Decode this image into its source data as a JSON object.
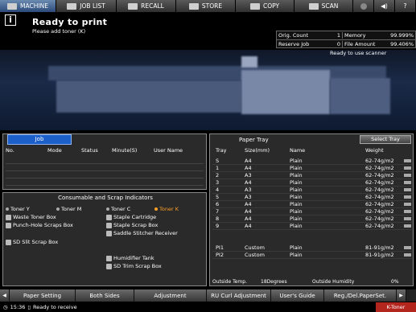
{
  "tabs": {
    "machine": "MACHINE",
    "job_list": "JOB LIST",
    "recall": "RECALL",
    "store": "STORE",
    "copy": "COPY",
    "scan": "SCAN"
  },
  "status": {
    "title": "Ready to print",
    "subtitle": "Please add toner (K)",
    "scanner": "Ready to use scanner"
  },
  "counters": {
    "orig_count_label": "Orig. Count",
    "orig_count_value": "1",
    "memory_label": "Memory",
    "memory_value": "99.999%",
    "reserve_job_label": "Reserve Job",
    "reserve_job_value": "0",
    "file_amount_label": "File Amount",
    "file_amount_value": "99.406%"
  },
  "job_panel": {
    "tab": "Job",
    "columns": [
      "No.",
      "Mode",
      "Status",
      "Minute(S)",
      "User Name"
    ]
  },
  "consumables": {
    "title": "Consumable and Scrap Indicators",
    "items": [
      "Toner Y",
      "Toner M",
      "Toner C",
      "Toner K",
      "Waste Toner Box",
      "Staple Cartridge",
      "Punch-Hole Scraps Box",
      "Staple Scrap Box",
      "Saddle Stitcher Receiver",
      "SD Slit Scrap Box",
      "Humidifier Tank",
      "SD Trim Scrap Box"
    ]
  },
  "paper_tray": {
    "title": "Paper Tray",
    "select_button": "Select Tray",
    "columns": [
      "Tray",
      "Size(mm)",
      "Name",
      "Weight"
    ],
    "rows": [
      {
        "tray": "S",
        "size": "A4",
        "name": "Plain",
        "weight": "62-74g/m2"
      },
      {
        "tray": "1",
        "size": "A4",
        "name": "Plain",
        "weight": "62-74g/m2"
      },
      {
        "tray": "2",
        "size": "A3",
        "name": "Plain",
        "weight": "62-74g/m2"
      },
      {
        "tray": "3",
        "size": "A4",
        "name": "Plain",
        "weight": "62-74g/m2"
      },
      {
        "tray": "4",
        "size": "A3",
        "name": "Plain",
        "weight": "62-74g/m2"
      },
      {
        "tray": "5",
        "size": "A3",
        "name": "Plain",
        "weight": "62-74g/m2"
      },
      {
        "tray": "6",
        "size": "A4",
        "name": "Plain",
        "weight": "62-74g/m2"
      },
      {
        "tray": "7",
        "size": "A4",
        "name": "Plain",
        "weight": "62-74g/m2"
      },
      {
        "tray": "8",
        "size": "A4",
        "name": "Plain",
        "weight": "62-74g/m2"
      },
      {
        "tray": "9",
        "size": "A4",
        "name": "Plain",
        "weight": "62-74g/m2"
      },
      {
        "tray": "PI1",
        "size": "Custom",
        "name": "Plain",
        "weight": "81-91g/m2"
      },
      {
        "tray": "PI2",
        "size": "Custom",
        "name": "Plain",
        "weight": "81-91g/m2"
      }
    ],
    "outside_temp_label": "Outside Temp.",
    "outside_temp_value": "18Degrees",
    "outside_humidity_label": "Outside Humidity",
    "outside_humidity_value": "0%"
  },
  "buttons": {
    "paper_setting": "Paper Setting",
    "both_sides": "Both Sides",
    "adjustment": "Adjustment",
    "ru_curl": "RU Curl Adjustment",
    "users_guide": "User's Guide",
    "reg_del": "Reg./Del.PaperSet."
  },
  "footer": {
    "time": "15:36",
    "status": "Ready to receive",
    "notice": "K-Toner"
  },
  "colors": {
    "active_tab": "#2b4a7a",
    "job_tab": "#1c5fc9",
    "toner_k": "#ffa028",
    "notice": "#b3261e"
  }
}
